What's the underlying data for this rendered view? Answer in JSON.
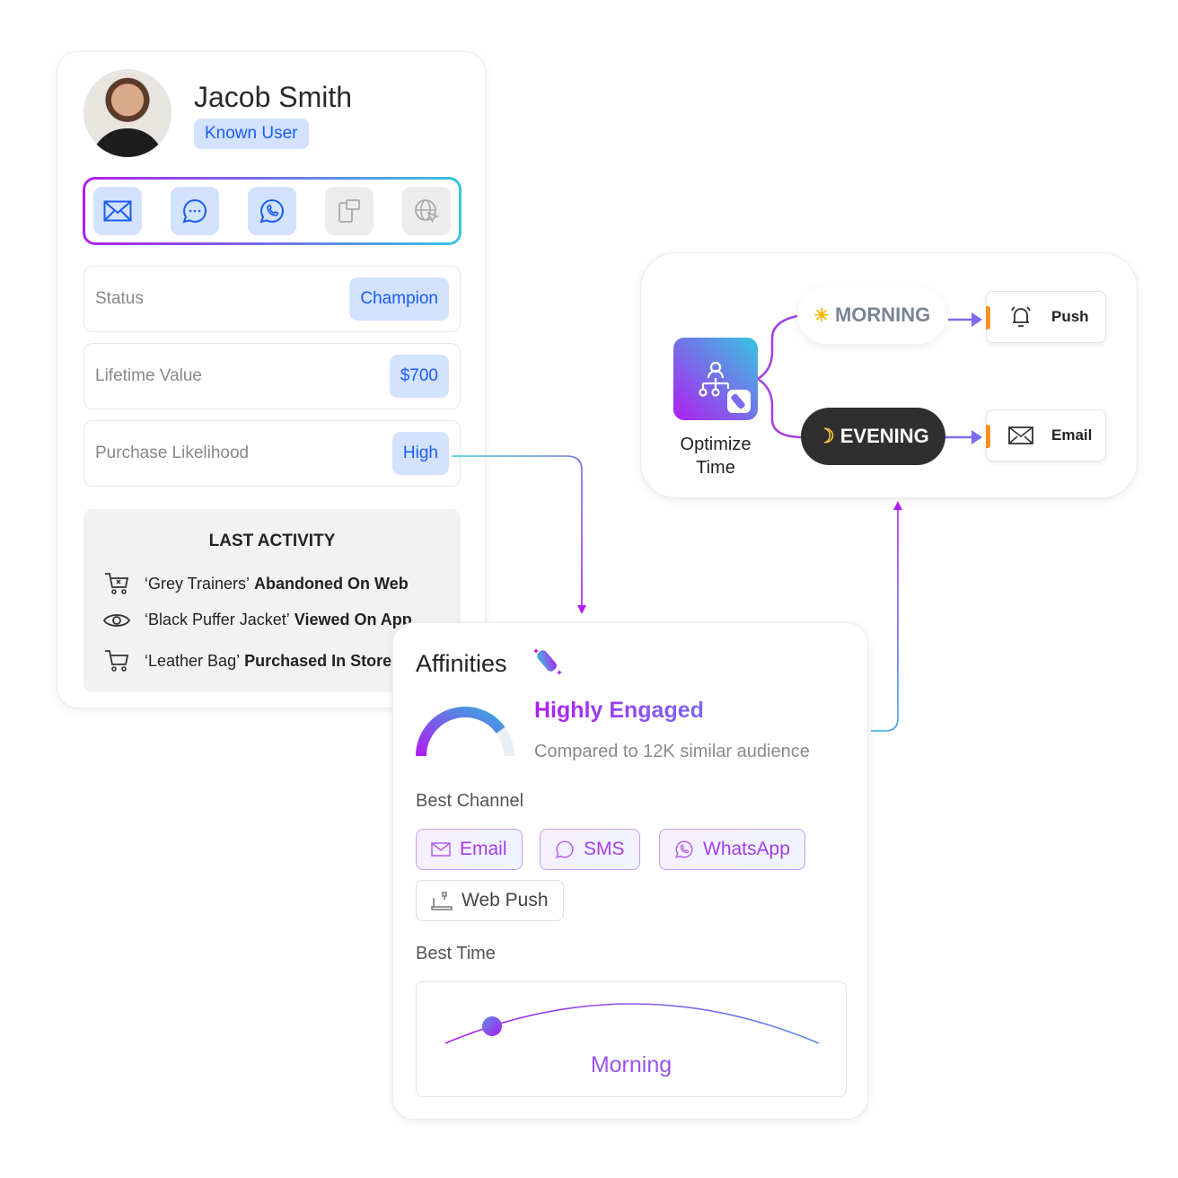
{
  "profile": {
    "name": "Jacob Smith",
    "badge": "Known User",
    "channels": [
      {
        "icon": "email-icon",
        "active": true
      },
      {
        "icon": "sms-chat-icon",
        "active": true
      },
      {
        "icon": "whatsapp-icon",
        "active": true
      },
      {
        "icon": "in-app-message-icon",
        "active": false
      },
      {
        "icon": "web-globe-cursor-icon",
        "active": false
      }
    ],
    "rows": [
      {
        "label": "Status",
        "value": "Champion"
      },
      {
        "label": "Lifetime Value",
        "value": "$700"
      },
      {
        "label": "Purchase Likelihood",
        "value": "High"
      }
    ],
    "last_activity": {
      "title": "LAST ACTIVITY",
      "items": [
        {
          "icon": "cart-x-icon",
          "item": "‘Grey Trainers’",
          "action": "Abandoned On Web"
        },
        {
          "icon": "eye-icon",
          "item": "‘Black Puffer Jacket’",
          "action": "Viewed On App"
        },
        {
          "icon": "cart-icon",
          "item": "‘Leather Bag’",
          "action": "Purchased In Store"
        }
      ]
    }
  },
  "affinities": {
    "title": "Affinities",
    "engagement": "Highly Engaged",
    "engagement_level_pct": 80,
    "compared": "Compared to 12K similar audience",
    "best_channel_label": "Best Channel",
    "best_channels": [
      {
        "label": "Email",
        "highlight": true
      },
      {
        "label": "SMS",
        "highlight": true
      },
      {
        "label": "WhatsApp",
        "highlight": true
      },
      {
        "label": "Web Push",
        "highlight": false
      }
    ],
    "best_time_label": "Best Time",
    "best_time": "Morning"
  },
  "optimize": {
    "label": "Optimize Time",
    "morning": "MORNING",
    "evening": "EVENING",
    "push": "Push",
    "email": "Email"
  },
  "colors": {
    "accent_purple": "#b01ef0",
    "accent_cyan": "#38c6e0",
    "blue": "#1a5cf0",
    "badge_bg": "#d3e2ff",
    "orange": "#f7901e"
  }
}
